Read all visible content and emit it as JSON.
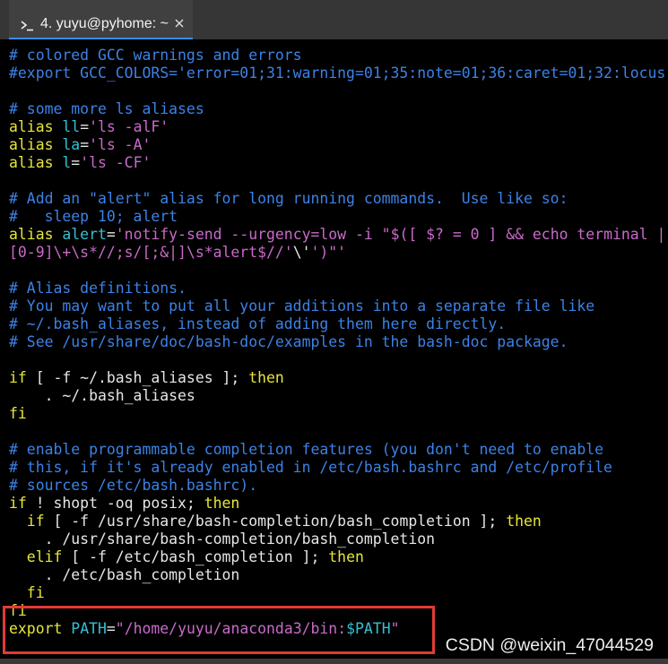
{
  "tab": {
    "title": "4. yuyu@pyhome: ~",
    "icon": "terminal-icon",
    "close_icon": "close-icon"
  },
  "syntax_colors": {
    "comment": "#3c82e6",
    "keyword": "#e6e63c",
    "identifier": "#33c1d3",
    "string": "#c96ac9",
    "plain": "#e6e6e6"
  },
  "terminal": {
    "background": "#000000",
    "lines": [
      [
        {
          "comment": "# colored GCC warnings and errors"
        }
      ],
      [
        {
          "comment": "#export GCC_COLORS='error=01;31:warning=01;35:note=01;36:caret=01;32:locus"
        }
      ],
      [],
      [
        {
          "comment": "# some more ls aliases"
        }
      ],
      [
        {
          "keyword": "alias"
        },
        {
          "plain": " "
        },
        {
          "identifier": "ll"
        },
        {
          "plain": "="
        },
        {
          "string": "'ls -alF'"
        }
      ],
      [
        {
          "keyword": "alias"
        },
        {
          "plain": " "
        },
        {
          "identifier": "la"
        },
        {
          "plain": "="
        },
        {
          "string": "'ls -A'"
        }
      ],
      [
        {
          "keyword": "alias"
        },
        {
          "plain": " "
        },
        {
          "identifier": "l"
        },
        {
          "plain": "="
        },
        {
          "string": "'ls -CF'"
        }
      ],
      [],
      [
        {
          "comment": "# Add an \"alert\" alias for long running commands.  Use like so:"
        }
      ],
      [
        {
          "comment": "#   sleep 10; alert"
        }
      ],
      [
        {
          "keyword": "alias"
        },
        {
          "plain": " "
        },
        {
          "identifier": "alert"
        },
        {
          "plain": "="
        },
        {
          "string": "'notify-send --urgency=low -i \"$([ $? = 0 ] && echo terminal |"
        }
      ],
      [
        {
          "string": "[0-9]\\+\\s*//;s/[;&|]\\s*alert$//'"
        },
        {
          "plain": "\\'"
        },
        {
          "string": "')\"'"
        }
      ],
      [],
      [
        {
          "comment": "# Alias definitions."
        }
      ],
      [
        {
          "comment": "# You may want to put all your additions into a separate file like"
        }
      ],
      [
        {
          "comment": "# ~/.bash_aliases, instead of adding them here directly."
        }
      ],
      [
        {
          "comment": "# See /usr/share/doc/bash-doc/examples in the bash-doc package."
        }
      ],
      [],
      [
        {
          "keyword": "if"
        },
        {
          "plain": " [ -f ~/.bash_aliases ]; "
        },
        {
          "keyword": "then"
        }
      ],
      [
        {
          "plain": "    . ~/.bash_aliases"
        }
      ],
      [
        {
          "keyword": "fi"
        }
      ],
      [],
      [
        {
          "comment": "# enable programmable completion features (you don't need to enable"
        }
      ],
      [
        {
          "comment": "# this, if it's already enabled in /etc/bash.bashrc and /etc/profile"
        }
      ],
      [
        {
          "comment": "# sources /etc/bash.bashrc)."
        }
      ],
      [
        {
          "keyword": "if"
        },
        {
          "plain": " ! shopt -oq posix; "
        },
        {
          "keyword": "then"
        }
      ],
      [
        {
          "plain": "  "
        },
        {
          "keyword": "if"
        },
        {
          "plain": " [ -f /usr/share/bash-completion/bash_completion ]; "
        },
        {
          "keyword": "then"
        }
      ],
      [
        {
          "plain": "    . /usr/share/bash-completion/bash_completion"
        }
      ],
      [
        {
          "plain": "  "
        },
        {
          "keyword": "elif"
        },
        {
          "plain": " [ -f /etc/bash_completion ]; "
        },
        {
          "keyword": "then"
        }
      ],
      [
        {
          "plain": "    . /etc/bash_completion"
        }
      ],
      [
        {
          "plain": "  "
        },
        {
          "keyword": "fi"
        }
      ],
      [
        {
          "keyword": "fi"
        }
      ],
      [
        {
          "keyword": "export"
        },
        {
          "plain": " "
        },
        {
          "identifier": "PATH"
        },
        {
          "plain": "="
        },
        {
          "string": "\"/home/yuyu/anaconda3/bin:"
        },
        {
          "identifier": "$PATH"
        },
        {
          "string": "\""
        }
      ]
    ]
  },
  "annotation": {
    "color": "#e23b35"
  },
  "watermark": {
    "text": "CSDN @weixin_47044529"
  }
}
